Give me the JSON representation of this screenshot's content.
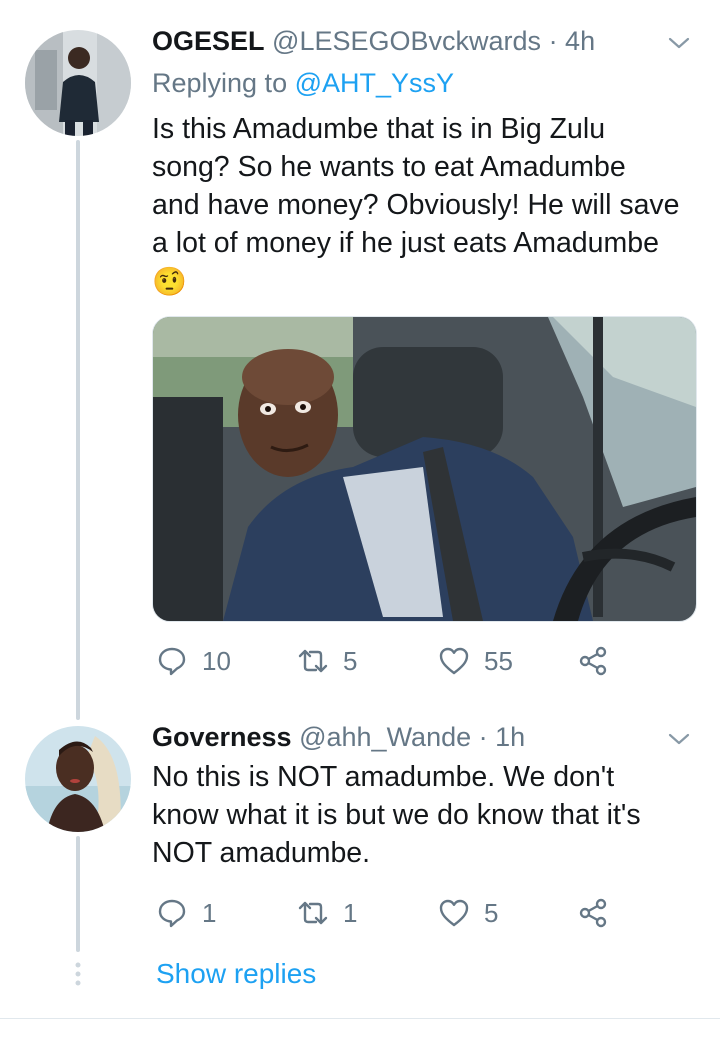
{
  "tweets": [
    {
      "name": "OGESEL",
      "handle": "@LESEGOBvckwards",
      "time": "· 4h",
      "reply_prefix": "Replying to",
      "reply_to": "@AHT_YssY",
      "text_lines": [
        "Is this Amadumbe that is in Big Zulu",
        "song? So he wants to eat Amadumbe",
        "and have money? Obviously! He will save",
        "a lot of money if he just eats Amadumbe"
      ],
      "emoji": "🤨",
      "replies": "10",
      "retweets": "5",
      "likes": "55"
    },
    {
      "name": "Governess",
      "handle": "@ahh_Wande",
      "time": "· 1h",
      "text_lines": [
        "No this is NOT amadumbe. We don't",
        "know what it is but we do know that it's",
        "NOT amadumbe."
      ],
      "replies": "1",
      "retweets": "1",
      "likes": "5"
    }
  ],
  "show_replies": "Show replies",
  "icons": {
    "reply": "reply-icon",
    "retweet": "retweet-icon",
    "like": "heart-icon",
    "share": "share-icon",
    "menu": "chevron-down-icon"
  },
  "colors": {
    "link": "#1da1f2",
    "muted": "#657786",
    "thread_line": "#cdd6dd"
  }
}
